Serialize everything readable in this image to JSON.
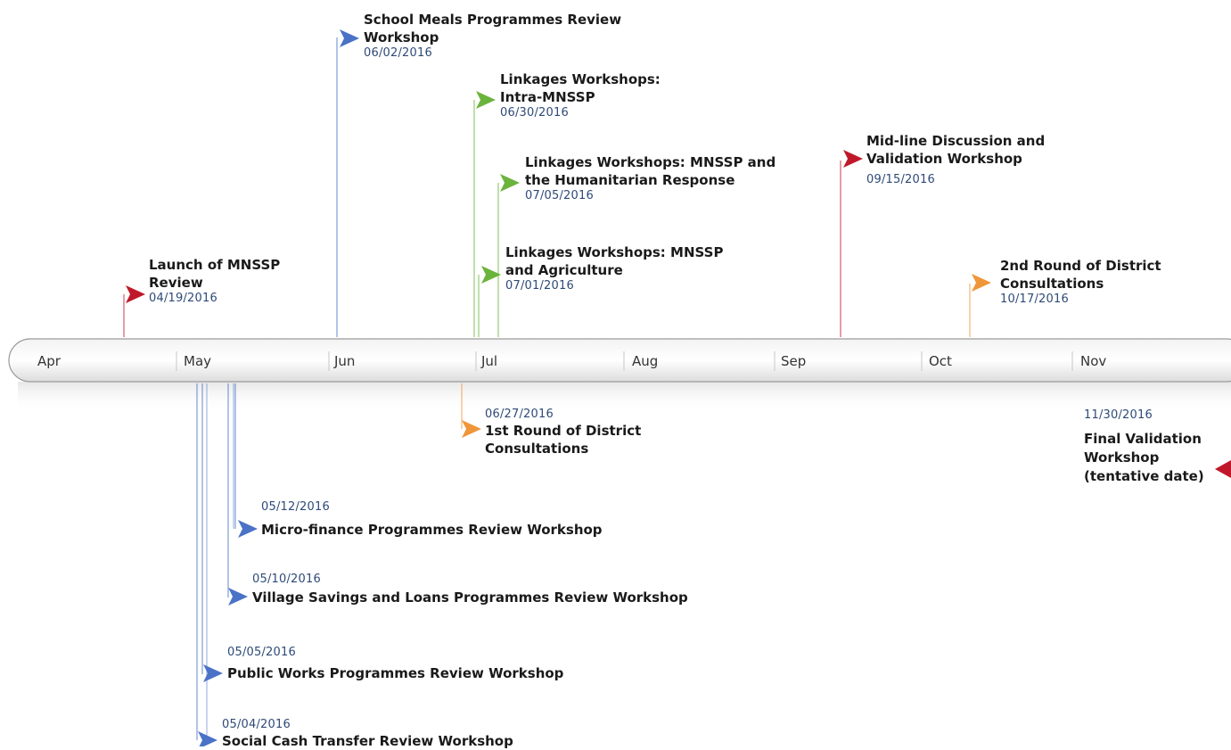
{
  "colors": {
    "red": "#c0182a",
    "blue": "#4a72c6",
    "green": "#6ab33c",
    "orange": "#f0963a",
    "date_text": "#2e4a78"
  },
  "axis": {
    "months": [
      "Apr",
      "May",
      "Jun",
      "Jul",
      "Aug",
      "Sep",
      "Oct",
      "Nov"
    ]
  },
  "events": [
    {
      "id": "launch",
      "title_lines": [
        "Launch of MNSSP",
        "Review"
      ],
      "date": "04/19/2016",
      "color": "red"
    },
    {
      "id": "school-meals",
      "title_lines": [
        "School Meals Programmes Review",
        "Workshop"
      ],
      "date": "06/02/2016",
      "color": "blue"
    },
    {
      "id": "intra-mnssp",
      "title_lines": [
        "Linkages Workshops:",
        "Intra-MNSSP"
      ],
      "date": "06/30/2016",
      "color": "green"
    },
    {
      "id": "humanitarian",
      "title_lines": [
        "Linkages Workshops: MNSSP and",
        "the Humanitarian Response"
      ],
      "date": "07/05/2016",
      "color": "green"
    },
    {
      "id": "agriculture",
      "title_lines": [
        "Linkages Workshops: MNSSP",
        "and Agriculture"
      ],
      "date": "07/01/2016",
      "color": "green"
    },
    {
      "id": "midline",
      "title_lines": [
        "Mid-line Discussion and",
        "Validation Workshop"
      ],
      "date": "09/15/2016",
      "color": "red"
    },
    {
      "id": "second-round",
      "title_lines": [
        "2nd Round of District",
        "Consultations"
      ],
      "date": "10/17/2016",
      "color": "orange"
    },
    {
      "id": "first-round",
      "title_lines": [
        "1st Round of District",
        "Consultations"
      ],
      "date": "06/27/2016",
      "color": "orange"
    },
    {
      "id": "final-validation",
      "title_lines": [
        "Final Validation",
        "Workshop",
        "(tentative date)"
      ],
      "date": "11/30/2016",
      "color": "red"
    },
    {
      "id": "micro-finance",
      "title_lines": [
        "Micro-finance Programmes Review Workshop"
      ],
      "date": "05/12/2016",
      "color": "blue"
    },
    {
      "id": "village-savings",
      "title_lines": [
        "Village Savings and Loans Programmes Review Workshop"
      ],
      "date": "05/10/2016",
      "color": "blue"
    },
    {
      "id": "public-works",
      "title_lines": [
        "Public Works Programmes Review Workshop"
      ],
      "date": "05/05/2016",
      "color": "blue"
    },
    {
      "id": "social-cash",
      "title_lines": [
        "Social Cash Transfer Review Workshop"
      ],
      "date": "05/04/2016",
      "color": "blue"
    }
  ]
}
